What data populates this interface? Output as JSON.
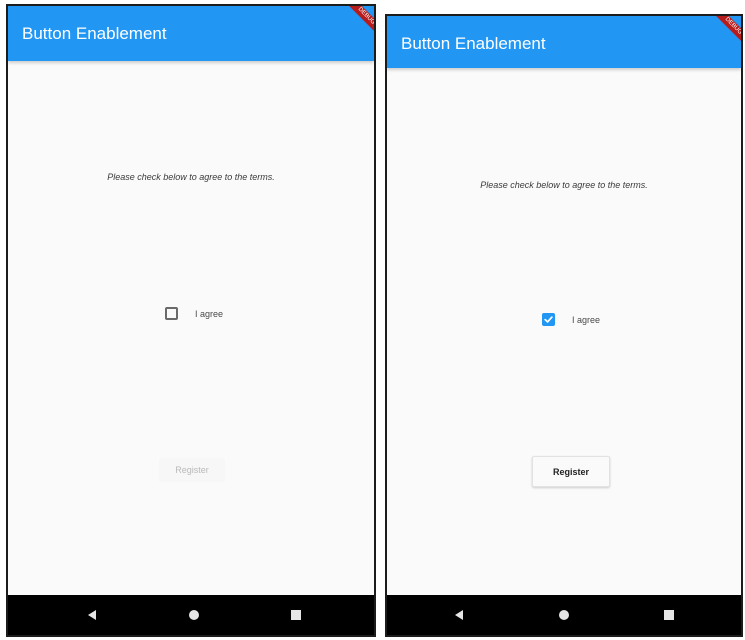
{
  "app": {
    "title": "Button Enablement",
    "debug_banner": "DEBUG",
    "accent_color": "#2196f3"
  },
  "screens": [
    {
      "state": "unchecked",
      "terms_text": "Please check below to agree to the terms.",
      "checkbox": {
        "checked": false,
        "label": "I agree"
      },
      "register_button": {
        "label": "Register",
        "enabled": false
      }
    },
    {
      "state": "checked",
      "terms_text": "Please check below to agree to the terms.",
      "checkbox": {
        "checked": true,
        "label": "I agree"
      },
      "register_button": {
        "label": "Register",
        "enabled": true
      }
    }
  ],
  "navbar": {
    "icons": [
      "back-icon",
      "home-icon",
      "recents-icon"
    ]
  }
}
